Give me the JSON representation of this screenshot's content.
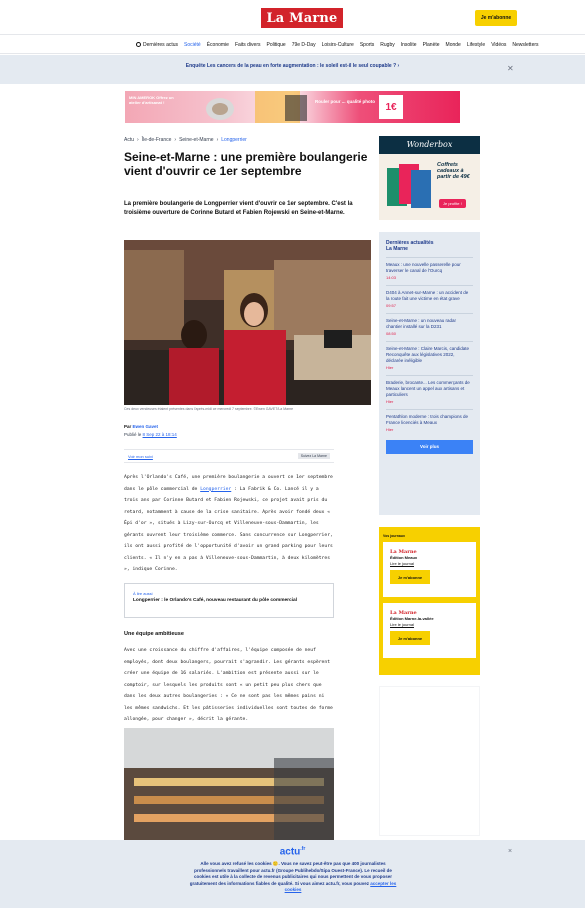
{
  "header": {
    "logo": "La Marne",
    "subscribe_label": "Je m'abonne"
  },
  "nav": {
    "items": [
      "Dernières actus",
      "Société",
      "Économie",
      "Faits divers",
      "Politique",
      "79e D-Day",
      "Loisirs-Culture",
      "Sports",
      "Rugby",
      "Insolite",
      "Planète",
      "Monde",
      "Lifestyle",
      "Vidéos",
      "Newsletters"
    ],
    "active": "Société"
  },
  "alert": {
    "text": "Enquête Les cancers de la peau en forte augmentation : le soleil est-il le seul coupable ?"
  },
  "ad_banner": {
    "left_text": "MIN AMEROK Offrez un atelier d'artisanat !",
    "right_text": "Rouler pour ... qualité photo",
    "price": "1€",
    "accent": "#e9245a"
  },
  "article": {
    "breadcrumb": [
      "Actu",
      "Île-de-France",
      "Seine-et-Marne",
      "Longperrier"
    ],
    "title": "Seine-et-Marne : une première boulangerie vient d'ouvrir ce 1er septembre",
    "lede": "La première boulangerie de Longperrier vient d'ouvrir ce 1er septembre. C'est la troisième ouverture de Corinne Butard et Fabien Rojewski en Seine-et-Marne.",
    "photo_caption": "Ces deux vendeuses étaient présentes dans l'après-midi ce mercredi 7 septembre. ©Ewen GAVET/La Marne",
    "author_prefix": "Par",
    "author": "Ewen Gavet",
    "date_prefix": "Publié le",
    "date": "8 Sep 22 à 18:14",
    "see_comments": "Voir mon suivi",
    "follow_label": "Suivez La Marne",
    "p1_before_link": "Après l'Orlando's Café, une première boulangerie a ouvert ce 1er septembre dans le pôle commercial de ",
    "p1_link": "Longperrier",
    "p1_after_link": " : La Fabrik & Co. Lancé il y a trois ans par Corinne Butard et Fabien Rojewski, ce projet avait pris du retard, notamment à cause de la crise sanitaire. Après avoir fondé deux « Épi d'or », situés à Lizy-sur-Ourcq et Villeneuve-sous-Dammartin, les gérants ouvrent leur troisième commerce. Sans concurrence sur Longperrier, ils ont aussi profité de l'opportunité d'avoir un grand parking pour leurs clients. « Il n'y en a pas à Villeneuve-sous-Dammartin, à deux kilomètres », indique Corinne.",
    "read_also_label": "À lire aussi",
    "read_also_title": "Longperrier : le Orlando's Café, nouveau restaurant du pôle commercial",
    "section_title": "Une équipe ambitieuse",
    "p2": "Avec une croissance du chiffre d'affaires, l'équipe composée de neuf employés, dont deux boulangers, pourrait s'agrandir. Les gérants espèrent créer une équipe de 16 salariés. L'ambition est présente aussi sur le comptoir, sur lesquels les produits sont « un petit peu plus chers que dans les deux autres boulangeries : « Ce ne sont pas les mêmes pains ni les mêmes sandwichs. Et les pâtisseries individuelles sont toutes de forme allongée, pour changer », décrit la gérante."
  },
  "side_ad": {
    "brand": "Wonderbox",
    "headline": "Coffrets cadeaux à partir de 49€",
    "cta": "Je profite !"
  },
  "latest": {
    "heading": "Dernières actualités",
    "source": "La Marne",
    "items": [
      {
        "title": "Meaux : une nouvelle passerelle pour traverser le canal de l'Ourcq",
        "time": "14:03"
      },
      {
        "title": "D404 à Annet-sur-Marne : un accident de la route fait une victime en état grave",
        "time": "09:57"
      },
      {
        "title": "Seine-et-Marne : un nouveau radar chantier installé sur la D231",
        "time": "08:50"
      },
      {
        "title": "Seine-et-Marne : Claire Marcis, candidate Reconquête aux législatives 2022, déclarée inéligible",
        "time": "Hier"
      },
      {
        "title": "Braderie, brocante... Les commerçants de Meaux lancent un appel aux artisans et particuliers",
        "time": "Hier"
      },
      {
        "title": "Pentathlon moderne : trois champions de France licenciés à Meaux",
        "time": "Hier"
      }
    ],
    "see_more": "Voir plus"
  },
  "journals": {
    "label": "Vos journaux",
    "cards": [
      {
        "logo": "La Marne",
        "edition": "Édition Meaux",
        "read": "Lire le journal",
        "cta": "Je m'abonne"
      },
      {
        "logo": "La Marne",
        "edition": "Édition Marne-la-vallée",
        "read": "Lire le journal",
        "cta": "Je m'abonne"
      }
    ]
  },
  "cookie": {
    "logo": "actu",
    "logo_suffix": ".fr",
    "text": "Alle vous avez refusé les cookies 😕. Vous ne savez peut-être pas que 400 journalistes professionnels travaillent pour actu.fr (Groupe Publihebdo/Sipa Ouest-France). Le recueil de cookies est utile à la collecte de revenus publicitaires qui nous permettent de vous proposer gratuitement des informations fiables de qualité. Si vous aimez actu.fr, vous pouvez",
    "link": "accepter les cookies",
    "close": "×"
  }
}
